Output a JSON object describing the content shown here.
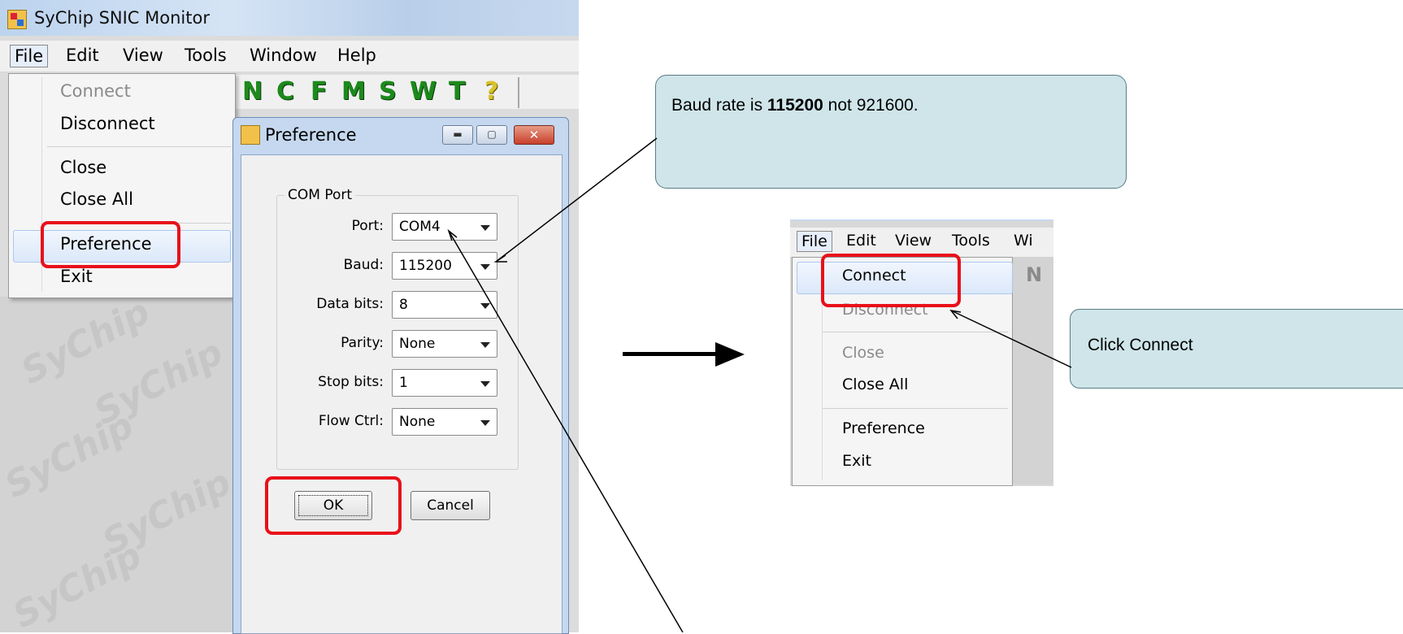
{
  "app": {
    "title": "SyChip SNIC Monitor",
    "menubar": [
      "File",
      "Edit",
      "View",
      "Tools",
      "Window",
      "Help"
    ],
    "toolbar": [
      "N",
      "C",
      "F",
      "M",
      "S",
      "W",
      "T",
      "?"
    ]
  },
  "file_menu": {
    "items": [
      {
        "label": "Connect",
        "enabled": false
      },
      {
        "label": "Disconnect",
        "enabled": true
      },
      {
        "label": "Close",
        "enabled": true
      },
      {
        "label": "Close All",
        "enabled": true
      },
      {
        "label": "Preference",
        "enabled": true,
        "highlighted": true
      },
      {
        "label": "Exit",
        "enabled": true
      }
    ]
  },
  "preference_dialog": {
    "title": "Preference",
    "group_label": "COM Port",
    "fields": [
      {
        "label": "Port:",
        "value": "COM4"
      },
      {
        "label": "Baud:",
        "value": "115200"
      },
      {
        "label": "Data bits:",
        "value": "8"
      },
      {
        "label": "Parity:",
        "value": "None"
      },
      {
        "label": "Stop bits:",
        "value": "1"
      },
      {
        "label": "Flow Ctrl:",
        "value": "None"
      }
    ],
    "ok_label": "OK",
    "cancel_label": "Cancel"
  },
  "callouts": {
    "baud_note_prefix": "Baud rate is ",
    "baud_note_bold": "115200",
    "baud_note_suffix": " not 921600.",
    "connect_note": "Click Connect"
  },
  "mini_screenshot": {
    "menubar": [
      "File",
      "Edit",
      "View",
      "Tools",
      "Wi"
    ],
    "toolbar_hint": "N",
    "items": [
      {
        "label": "Connect",
        "enabled": true,
        "highlighted": true
      },
      {
        "label": "Disconnect",
        "enabled": false
      },
      {
        "label": "Close",
        "enabled": false
      },
      {
        "label": "Close All",
        "enabled": true
      },
      {
        "label": "Preference",
        "enabled": true
      },
      {
        "label": "Exit",
        "enabled": true
      }
    ]
  },
  "colors": {
    "highlight_box": "#e8101a",
    "callout_fill": "#cfe5ea",
    "toolbar_letters": "#1c8a1c"
  }
}
